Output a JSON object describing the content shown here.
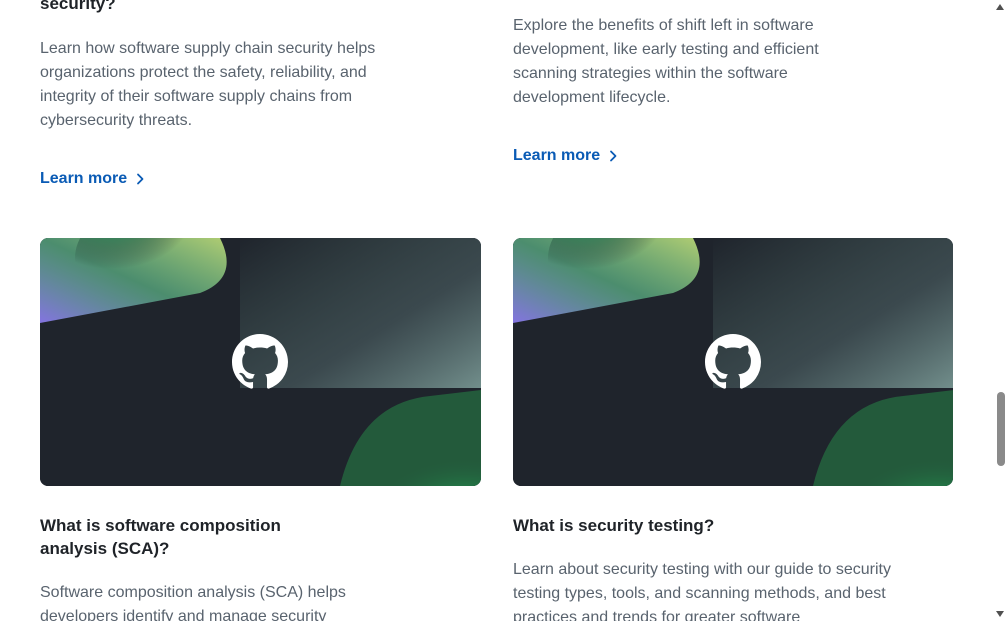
{
  "cards_top": [
    {
      "title_tail": "security?",
      "description": "Learn how software supply chain security helps organizations protect the safety, reliability, and integrity of their software supply chains from cybersecurity threats.",
      "link_label": "Learn more"
    },
    {
      "description": "Explore the benefits of shift left in software development, like early testing and efficient scanning strategies within the software development lifecycle.",
      "link_label": "Learn more"
    }
  ],
  "cards_bottom": [
    {
      "title": "What is software composition analysis (SCA)?",
      "description": "Software composition analysis (SCA) helps developers identify and manage security",
      "image_icon": "github-mark-icon"
    },
    {
      "title": "What is security testing?",
      "description": "Learn about security testing with our guide to security testing types, tools, and scanning methods, and best practices and trends for greater software",
      "image_icon": "github-mark-icon"
    }
  ],
  "colors": {
    "link": "#0a5bb5",
    "heading": "#1f2328",
    "body_text": "#59636e",
    "card_bg": "#1e232b",
    "accent_green": "#3ddc5a",
    "accent_purple": "#a78bfa"
  }
}
